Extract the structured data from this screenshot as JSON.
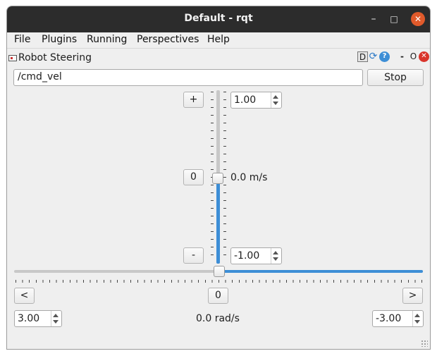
{
  "window": {
    "title": "Default - rqt",
    "controls": {
      "minimize": "–",
      "maximize": "□",
      "close": "✕"
    }
  },
  "menu": {
    "items": [
      {
        "label": "File"
      },
      {
        "label": "Plugins"
      },
      {
        "label": "Running"
      },
      {
        "label": "Perspectives"
      },
      {
        "label": "Help"
      }
    ]
  },
  "dock": {
    "title": "Robot Steering",
    "d_label": "D",
    "help_label": "?",
    "minus_label": "-",
    "float_label": "O",
    "close_label": "✕"
  },
  "topic": {
    "value": "/cmd_vel"
  },
  "stop_button": {
    "label": "Stop"
  },
  "linear": {
    "plus_label": "+",
    "zero_label": "0",
    "minus_label": "-",
    "max_value": "1.00",
    "min_value": "-1.00",
    "current_label": "0.0 m/s",
    "slider_fraction": 0.5
  },
  "angular": {
    "left_label": "<",
    "zero_label": "0",
    "right_label": ">",
    "left_value": "3.00",
    "right_value": "-3.00",
    "current_label": "0.0 rad/s",
    "slider_fraction": 0.5
  },
  "colors": {
    "accent": "#3d8ed6",
    "titlebar": "#2c2c2c",
    "close": "#e05a2b"
  }
}
